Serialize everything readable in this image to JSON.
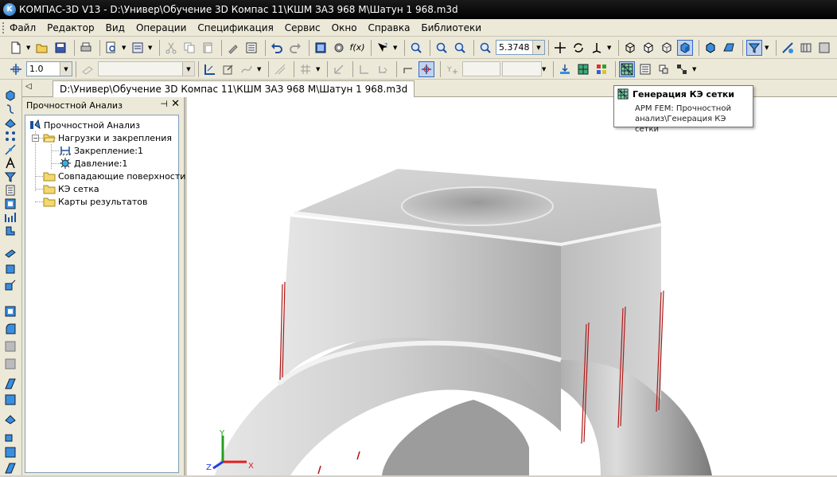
{
  "window": {
    "title": "КОМПАС-3D V13 - D:\\Универ\\Обучение 3D Компас 11\\КШМ ЗАЗ 968 М\\Шатун 1 968.m3d",
    "icon_letter": "K"
  },
  "menu": [
    {
      "key": "file",
      "label": "Файл"
    },
    {
      "key": "editor",
      "label": "Редактор"
    },
    {
      "key": "view",
      "label": "Вид"
    },
    {
      "key": "operations",
      "label": "Операции"
    },
    {
      "key": "spec",
      "label": "Спецификация"
    },
    {
      "key": "service",
      "label": "Сервис"
    },
    {
      "key": "window",
      "label": "Окно"
    },
    {
      "key": "help",
      "label": "Справка"
    },
    {
      "key": "libraries",
      "label": "Библиотеки"
    }
  ],
  "toolbar": {
    "zoom_value": "5.3748",
    "step_value": "1.0",
    "fx_label": "f(x)"
  },
  "document_tab": {
    "label": "D:\\Универ\\Обучение 3D Компас 11\\КШМ ЗАЗ 968 М\\Шатун 1 968.m3d"
  },
  "tree_panel": {
    "title": "Прочностной Анализ",
    "pin": "⊣",
    "close": "✕",
    "nodes": {
      "root": "Прочностной Анализ",
      "loads": "Нагрузки и закрепления",
      "fixing": "Закрепление:1",
      "pressure": "Давление:1",
      "matching": "Совпадающие поверхности",
      "mesh": "КЭ сетка",
      "maps": "Карты результатов"
    }
  },
  "tooltip": {
    "title": "Генерация КЭ сетки",
    "desc_line1": "APM FEM: Прочностной",
    "desc_line2": "анализ\\Генерация КЭ сетки"
  },
  "axes": {
    "x": "X",
    "y": "Y",
    "z": "Z"
  },
  "colors": {
    "accent": "#316ac5",
    "load_lines": "#b01818",
    "axis_x": "#e02020",
    "axis_y": "#20a020",
    "axis_z": "#2040e0"
  }
}
